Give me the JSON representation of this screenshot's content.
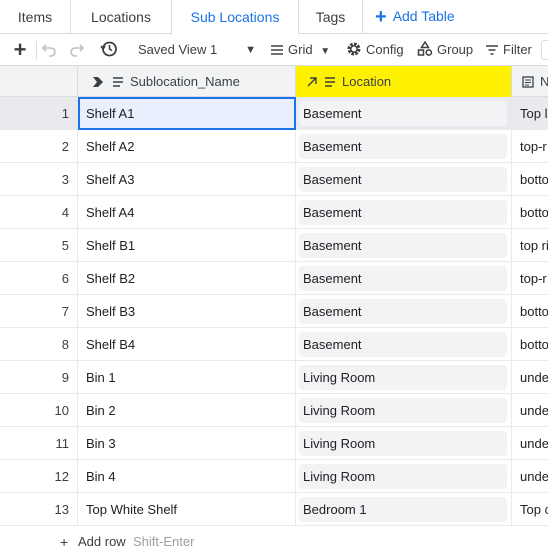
{
  "tabs": [
    {
      "label": "Items"
    },
    {
      "label": "Locations"
    },
    {
      "label": "Sub Locations"
    },
    {
      "label": "Tags"
    }
  ],
  "add_table_label": "Add Table",
  "toolbar": {
    "view_label": "Saved View 1",
    "grid_label": "Grid",
    "config_label": "Config",
    "group_label": "Group",
    "filter_label": "Filter"
  },
  "columns": {
    "name": "Sublocation_Name",
    "location": "Location",
    "next": "N"
  },
  "rows": [
    {
      "num": "1",
      "name": "Shelf A1",
      "location": "Basement",
      "next": "Top l"
    },
    {
      "num": "2",
      "name": "Shelf A2",
      "location": "Basement",
      "next": "top-r"
    },
    {
      "num": "3",
      "name": "Shelf A3",
      "location": "Basement",
      "next": "botto"
    },
    {
      "num": "4",
      "name": "Shelf A4",
      "location": "Basement",
      "next": "botto"
    },
    {
      "num": "5",
      "name": "Shelf B1",
      "location": "Basement",
      "next": "top ri"
    },
    {
      "num": "6",
      "name": "Shelf B2",
      "location": "Basement",
      "next": "top-r"
    },
    {
      "num": "7",
      "name": "Shelf B3",
      "location": "Basement",
      "next": "botto"
    },
    {
      "num": "8",
      "name": "Shelf B4",
      "location": "Basement",
      "next": "botto"
    },
    {
      "num": "9",
      "name": "Bin 1",
      "location": "Living Room",
      "next": "unde"
    },
    {
      "num": "10",
      "name": "Bin 2",
      "location": "Living Room",
      "next": "unde"
    },
    {
      "num": "11",
      "name": "Bin 3",
      "location": "Living Room",
      "next": "unde"
    },
    {
      "num": "12",
      "name": "Bin 4",
      "location": "Living Room",
      "next": "unde"
    },
    {
      "num": "13",
      "name": "Top White Shelf",
      "location": "Bedroom 1",
      "next": "Top c"
    }
  ],
  "add_row": {
    "label": "Add row",
    "hint": "Shift-Enter"
  },
  "colors": {
    "accent": "#1a73e8",
    "highlight": "#fff200"
  }
}
